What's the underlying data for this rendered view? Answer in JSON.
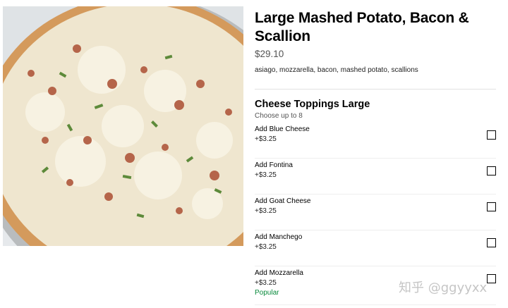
{
  "item": {
    "title": "Large Mashed Potato, Bacon & Scallion",
    "price": "$29.10",
    "description": "asiago, mozzarella, bacon, mashed potato, scallions"
  },
  "section": {
    "title": "Cheese Toppings Large",
    "subtitle": "Choose up to 8",
    "options": [
      {
        "name": "Add Blue Cheese",
        "price": "+$3.25",
        "tag": "",
        "checked": false
      },
      {
        "name": "Add Fontina",
        "price": "+$3.25",
        "tag": "",
        "checked": false
      },
      {
        "name": "Add Goat Cheese",
        "price": "+$3.25",
        "tag": "",
        "checked": false
      },
      {
        "name": "Add Manchego",
        "price": "+$3.25",
        "tag": "",
        "checked": false
      },
      {
        "name": "Add Mozzarella",
        "price": "+$3.25",
        "tag": "Popular",
        "checked": false
      }
    ]
  },
  "watermark": "知乎 @ggyyxx",
  "colors": {
    "popular": "#06893a",
    "text_secondary": "#545454",
    "divider": "#e2e2e2"
  }
}
